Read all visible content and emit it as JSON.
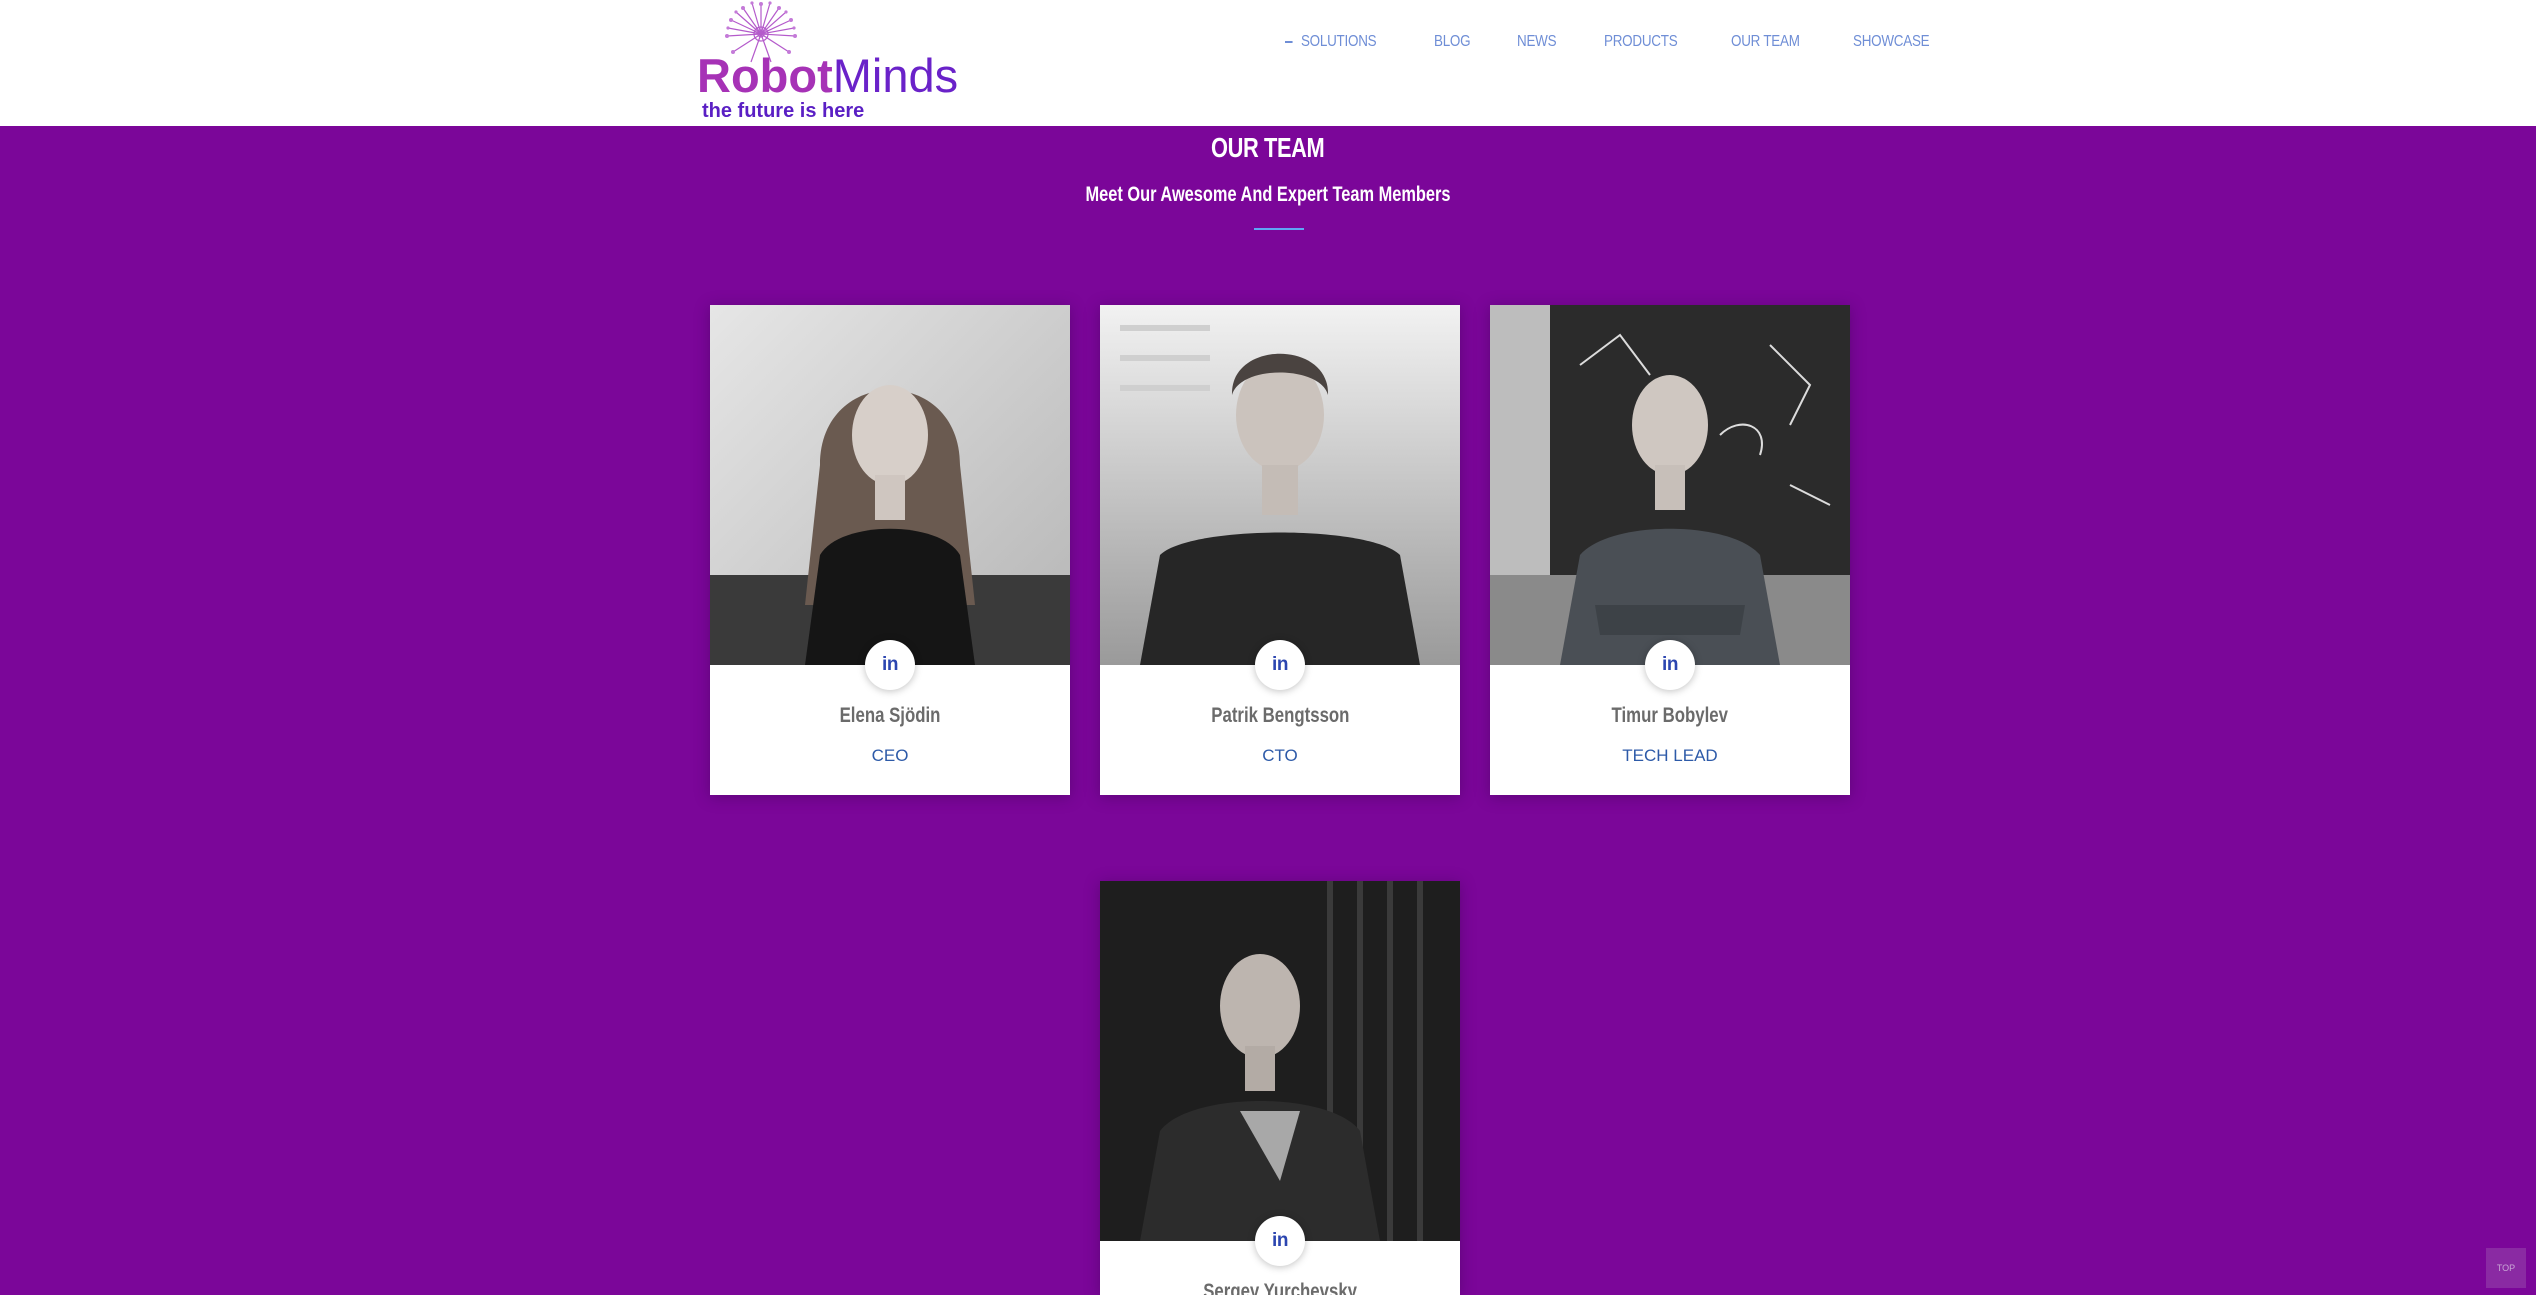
{
  "brand": {
    "name_part1": "Robot",
    "name_part2": "Minds",
    "tagline": "the future is here",
    "colors": {
      "robot": "#a632b6",
      "minds": "#6a22c9",
      "tagline": "#5a1fc4"
    }
  },
  "nav": {
    "items": [
      {
        "label": "SOLUTIONS",
        "active": true
      },
      {
        "label": "BLOG"
      },
      {
        "label": "NEWS"
      },
      {
        "label": "PRODUCTS"
      },
      {
        "label": "OUR TEAM"
      },
      {
        "label": "SHOWCASE"
      }
    ]
  },
  "section": {
    "title": "OUR TEAM",
    "subtitle": "Meet Our Awesome And Expert Team Members"
  },
  "team": [
    {
      "name": "Elena Sjödin",
      "role": "CEO",
      "social_icon": "linkedin-icon",
      "social_label": "in"
    },
    {
      "name": "Patrik Bengtsson",
      "role": "CTO",
      "social_icon": "linkedin-icon",
      "social_label": "in"
    },
    {
      "name": "Timur Bobylev",
      "role": "TECH LEAD",
      "social_icon": "linkedin-icon",
      "social_label": "in"
    },
    {
      "name": "Sergey Yurchevsky",
      "role": "",
      "social_icon": "linkedin-icon",
      "social_label": "in"
    }
  ],
  "back_to_top": {
    "label": "TOP"
  },
  "colors": {
    "background": "#7b0699",
    "accent_line": "#5ea6f5",
    "role_text": "#2d5aa8",
    "linkedin": "#2c46b0"
  }
}
